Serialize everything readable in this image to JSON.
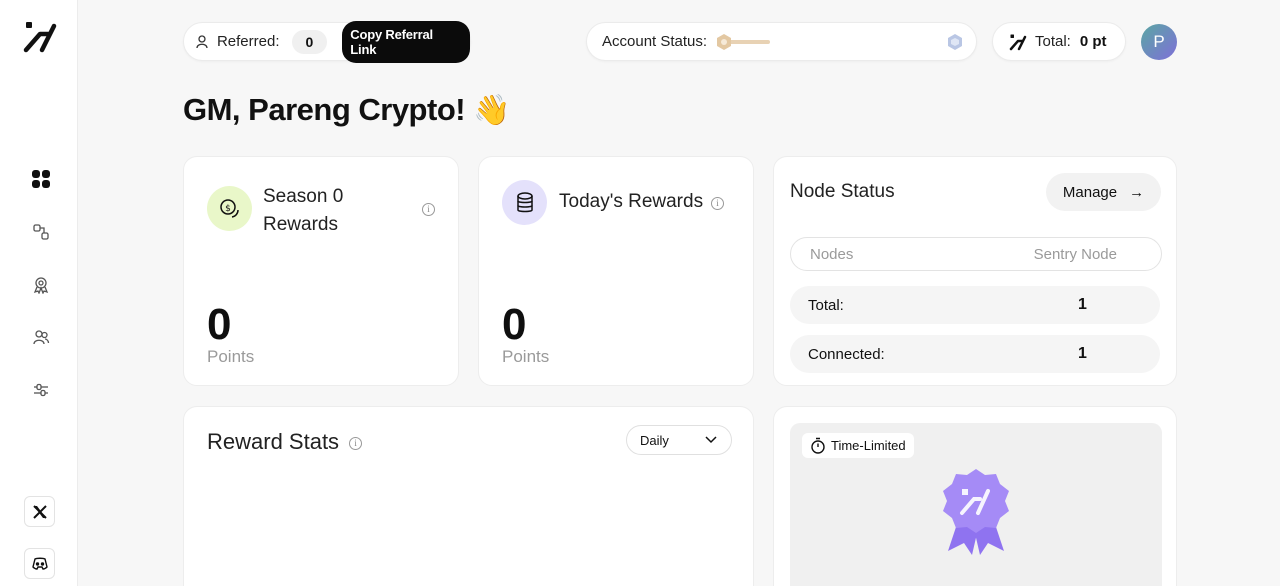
{
  "header": {
    "referred_label": "Referred:",
    "referred_count": "0",
    "copy_referral_label": "Copy Referral Link",
    "account_status_label": "Account Status:",
    "account_status_level": 0.22,
    "total_label": "Total:",
    "total_value": "0 pt",
    "avatar_initial": "P"
  },
  "greeting": {
    "text": "GM, Pareng Crypto!",
    "emoji": "👋"
  },
  "season_card": {
    "title_line1": "Season 0",
    "title_line2": "Rewards",
    "value": "0",
    "unit": "Points"
  },
  "today_card": {
    "title": "Today's Rewards",
    "value": "0",
    "unit": "Points"
  },
  "node_status": {
    "title": "Node Status",
    "manage_label": "Manage",
    "arrow": "→",
    "col_nodes": "Nodes",
    "col_type": "Sentry Node",
    "rows": [
      {
        "label": "Total:",
        "value": "1"
      },
      {
        "label": "Connected:",
        "value": "1"
      }
    ]
  },
  "reward_stats": {
    "title": "Reward Stats",
    "period": "Daily"
  },
  "promo": {
    "badge": "Time-Limited"
  },
  "colors": {
    "accent_purple": "#8b6cf2",
    "season_icon_bg": "#e9f7c9",
    "today_icon_bg": "#e4e1fb",
    "status_bar": "#e8d2b4"
  }
}
